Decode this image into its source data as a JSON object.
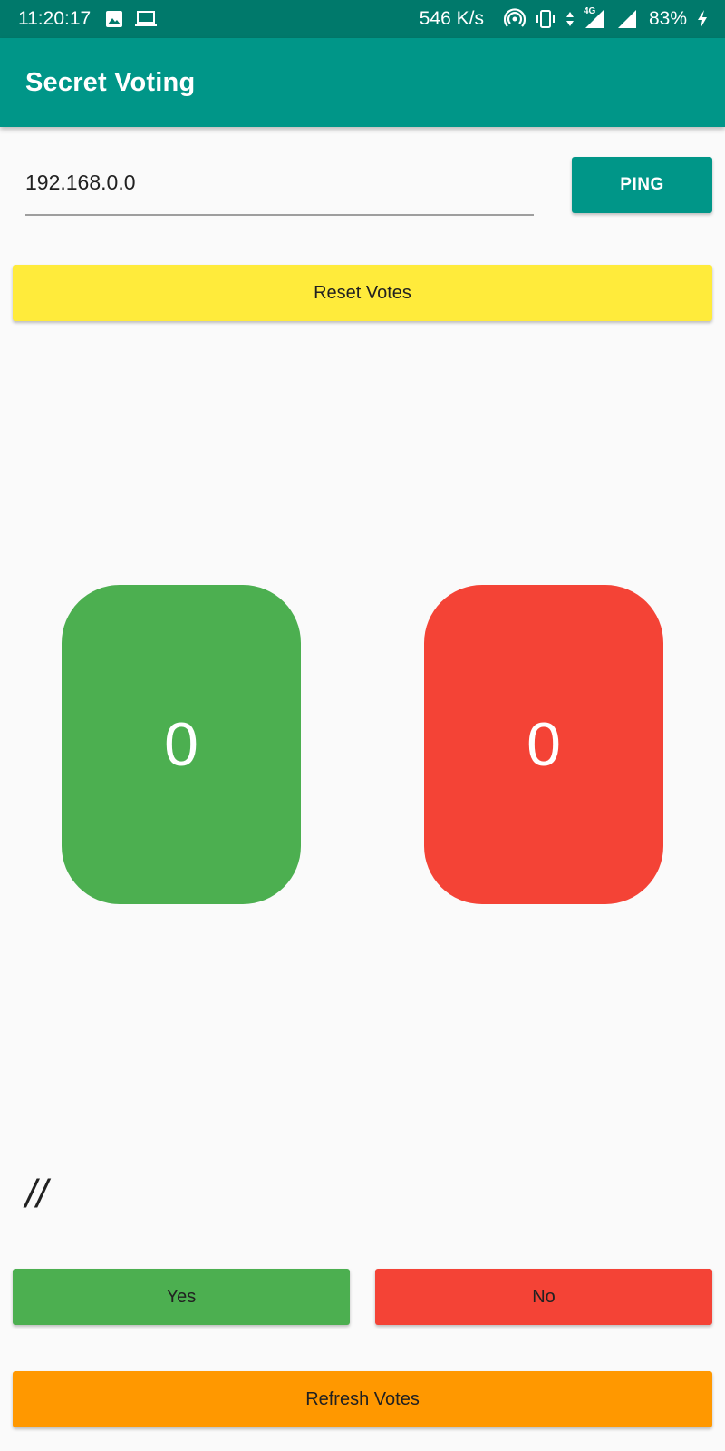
{
  "status_bar": {
    "time": "11:20:17",
    "network_speed": "546 K/s",
    "network_type": "4G",
    "battery": "83%",
    "left_icons": [
      "image-icon",
      "laptop-icon"
    ],
    "right_icons": [
      "hotspot-icon",
      "vibrate-icon",
      "data-arrows-icon",
      "signal-icon",
      "signal-full-icon",
      "charging-bolt-icon"
    ]
  },
  "app_bar": {
    "title": "Secret Voting"
  },
  "server": {
    "ip_value": "192.168.0.0",
    "ping_label": "PING"
  },
  "controls": {
    "reset_label": "Reset Votes",
    "yes_label": "Yes",
    "no_label": "No",
    "refresh_label": "Refresh Votes"
  },
  "votes": {
    "yes_count": "0",
    "no_count": "0"
  },
  "status_text": "//",
  "colors": {
    "status_bar": "#00796b",
    "app_bar": "#009688",
    "yes": "#4caf50",
    "no": "#f44336",
    "reset": "#ffeb3b",
    "refresh": "#ff9800"
  }
}
